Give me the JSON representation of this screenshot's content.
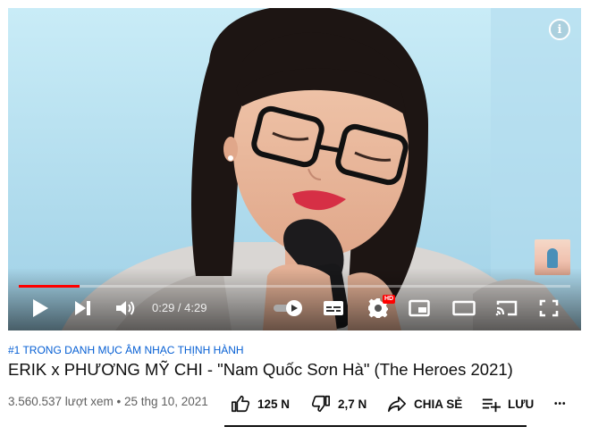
{
  "player": {
    "info_glyph": "i",
    "time_current": "0:29",
    "time_separator": " / ",
    "time_total": "4:29",
    "progress_played_fraction": 0.11,
    "progress_loaded_fraction": 0.11,
    "hd_badge": "HD",
    "icons": [
      "play-icon",
      "next-icon",
      "volume-icon",
      "autoplay-toggle-icon",
      "subtitles-icon",
      "settings-icon",
      "miniplayer-icon",
      "theater-icon",
      "cast-icon",
      "fullscreen-icon"
    ],
    "accent_color": "#ff0000"
  },
  "video": {
    "category": "#1 TRONG DANH MỤC ÂM NHẠC THỊNH HÀNH",
    "title": "ERIK x PHƯƠNG MỸ CHI - \"Nam Quốc Sơn Hà\" (The Heroes 2021)",
    "views": "3.560.537 lượt xem",
    "separator": " • ",
    "date": "25 thg 10, 2021"
  },
  "actions": {
    "like_count": "125 N",
    "dislike_count": "2,7 N",
    "share_label": "CHIA SẺ",
    "save_label": "LƯU",
    "more_glyph": "•••"
  }
}
